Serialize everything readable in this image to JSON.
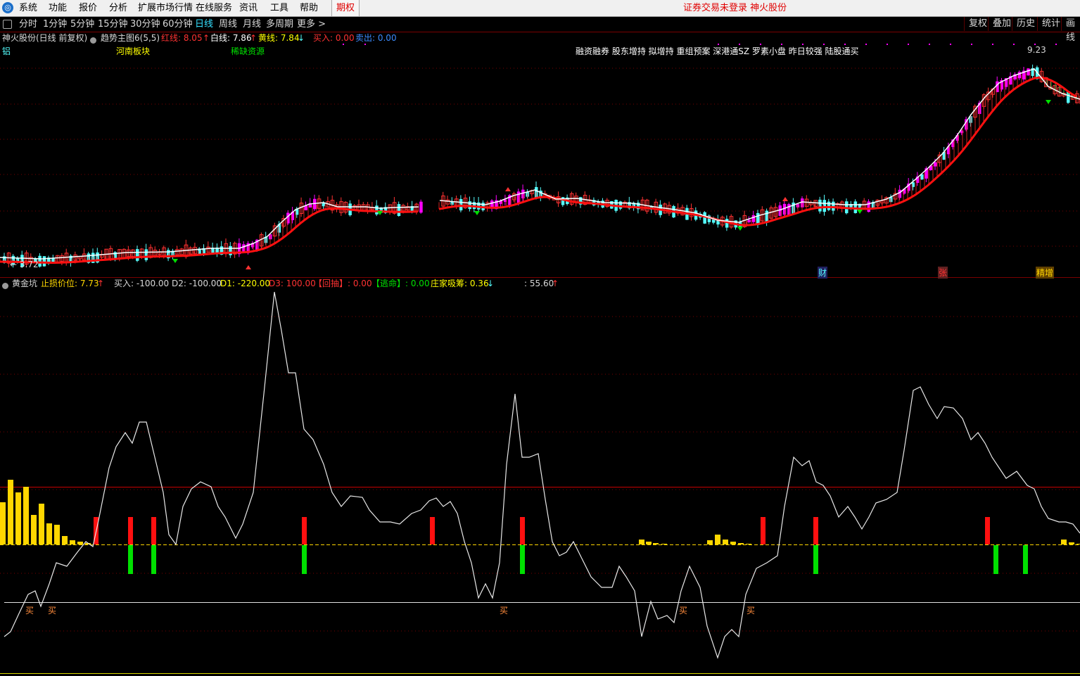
{
  "menubar": {
    "items": [
      "系统",
      "功能",
      "报价",
      "分析",
      "扩展市场行情",
      "在线服务",
      "资讯",
      "工具",
      "帮助"
    ],
    "option_tab": "期权",
    "status": "证券交易未登录  神火股份"
  },
  "periodbar": {
    "items": [
      "分时",
      "1分钟",
      "5分钟",
      "15分钟",
      "30分钟",
      "60分钟",
      "日线",
      "周线",
      "月线",
      "多周期",
      "更多 >"
    ],
    "active": "日线",
    "right_buttons": [
      "复权",
      "叠加",
      "历史",
      "统计",
      "画线"
    ]
  },
  "main_info": {
    "stock": "神火股份(日线 前复权)",
    "indicator": "趋势主图6(5,5)",
    "red_label": "红线: 8.05",
    "white_label": "白线: 7.86",
    "yellow_label": "黄线: 7.84",
    "buy_label": "买入: 0.00",
    "sell_label": "卖出: 0.00"
  },
  "tags_row": {
    "aluminum": "铝",
    "henan": "河南板块",
    "rare": "稀缺资源",
    "concepts": "融资融券 股东增持 拟增持 重组预案 深港通SZ 罗素小盘 昨日较强 陆股通买"
  },
  "price_markers": {
    "low": "3.72",
    "high": "9.23"
  },
  "event_tags": {
    "cai": "财",
    "zhang": "张",
    "jingzeng": "精增"
  },
  "sub_info": {
    "name": "黄金坑",
    "stop_loss": "止损价位: 7.73",
    "buy": "买入: -100.00",
    "d2": "D2: -100.00",
    "d1": "D1: -220.00",
    "d3": "D3: 100.00",
    "pullback": "【回抽】: 0.00",
    "escape": "【逃命】: 0.00",
    "accumulate": "庄家吸筹: 0.36",
    "extra": ": 55.60"
  },
  "buy_signal_label": "买",
  "colors": {
    "up": "#ff3232",
    "down": "#54fcfc",
    "magenta": "#ff00ff",
    "red_line": "#ff1010",
    "yellow": "#ffd700",
    "green": "#00e000",
    "white": "#ffffff"
  }
}
